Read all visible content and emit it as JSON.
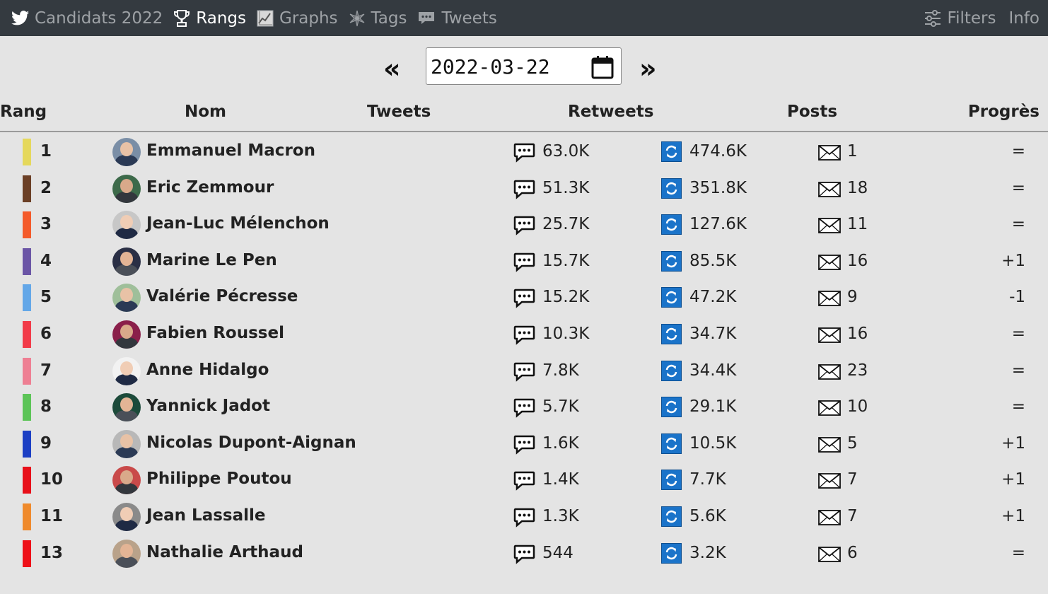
{
  "nav": {
    "brand_label": "Candidats 2022",
    "items": [
      {
        "label": "Rangs",
        "icon": "trophy-icon",
        "active": true
      },
      {
        "label": "Graphs",
        "icon": "chart-icon",
        "active": false
      },
      {
        "label": "Tags",
        "icon": "tags-icon",
        "active": false
      },
      {
        "label": "Tweets",
        "icon": "speech-icon",
        "active": false
      }
    ],
    "filters_label": "Filters",
    "info_label": "Info"
  },
  "date_picker": {
    "prev_label": "«",
    "next_label": "»",
    "value": "2022-03-22"
  },
  "table": {
    "headers": {
      "rang": "Rang",
      "nom": "Nom",
      "tweets": "Tweets",
      "retweets": "Retweets",
      "posts": "Posts",
      "progres": "Progrès"
    },
    "rows": [
      {
        "rank": "1",
        "name": "Emmanuel Macron",
        "tweets": "63.0K",
        "retweets": "474.6K",
        "posts": "1",
        "progress": "=",
        "color": "#e5d85c"
      },
      {
        "rank": "2",
        "name": "Eric Zemmour",
        "tweets": "51.3K",
        "retweets": "351.8K",
        "posts": "18",
        "progress": "=",
        "color": "#6b3f26"
      },
      {
        "rank": "3",
        "name": "Jean-Luc Mélenchon",
        "tweets": "25.7K",
        "retweets": "127.6K",
        "posts": "11",
        "progress": "=",
        "color": "#f45a2a"
      },
      {
        "rank": "4",
        "name": "Marine Le Pen",
        "tweets": "15.7K",
        "retweets": "85.5K",
        "posts": "16",
        "progress": "+1",
        "color": "#6b55a6"
      },
      {
        "rank": "5",
        "name": "Valérie Pécresse",
        "tweets": "15.2K",
        "retweets": "47.2K",
        "posts": "9",
        "progress": "-1",
        "color": "#63a7e8"
      },
      {
        "rank": "6",
        "name": "Fabien Roussel",
        "tweets": "10.3K",
        "retweets": "34.7K",
        "posts": "16",
        "progress": "=",
        "color": "#f23b49"
      },
      {
        "rank": "7",
        "name": "Anne Hidalgo",
        "tweets": "7.8K",
        "retweets": "34.4K",
        "posts": "23",
        "progress": "=",
        "color": "#ee7f93"
      },
      {
        "rank": "8",
        "name": "Yannick Jadot",
        "tweets": "5.7K",
        "retweets": "29.1K",
        "posts": "10",
        "progress": "=",
        "color": "#5cc457"
      },
      {
        "rank": "9",
        "name": "Nicolas Dupont-Aignan",
        "tweets": "1.6K",
        "retweets": "10.5K",
        "posts": "5",
        "progress": "+1",
        "color": "#1c3fc4"
      },
      {
        "rank": "10",
        "name": "Philippe Poutou",
        "tweets": "1.4K",
        "retweets": "7.7K",
        "posts": "7",
        "progress": "+1",
        "color": "#e8101a"
      },
      {
        "rank": "11",
        "name": "Jean Lassalle",
        "tweets": "1.3K",
        "retweets": "5.6K",
        "posts": "7",
        "progress": "+1",
        "color": "#ef8a2c"
      },
      {
        "rank": "13",
        "name": "Nathalie Arthaud",
        "tweets": "544",
        "retweets": "3.2K",
        "posts": "6",
        "progress": "=",
        "color": "#ee1018"
      }
    ]
  }
}
